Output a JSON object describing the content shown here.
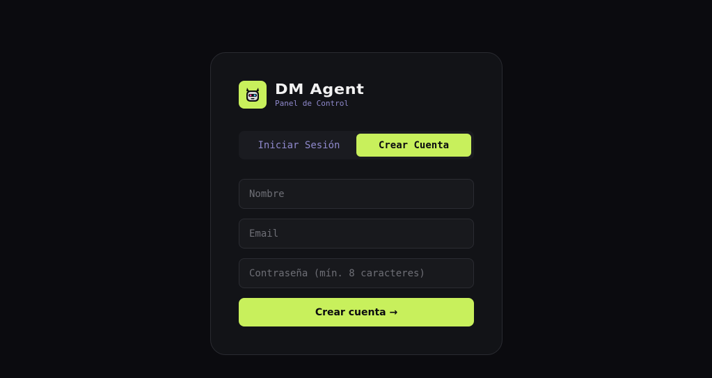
{
  "brand": {
    "title": "DM Agent",
    "subtitle": "Panel de Control",
    "logo_icon": "robot-icon",
    "accent_color": "#c8f05c"
  },
  "tabs": [
    {
      "label": "Iniciar Sesión",
      "active": false
    },
    {
      "label": "Crear Cuenta",
      "active": true
    }
  ],
  "form": {
    "name_placeholder": "Nombre",
    "email_placeholder": "Email",
    "password_placeholder": "Contraseña (mín. 8 caracteres)",
    "submit_label": "Crear cuenta →"
  }
}
